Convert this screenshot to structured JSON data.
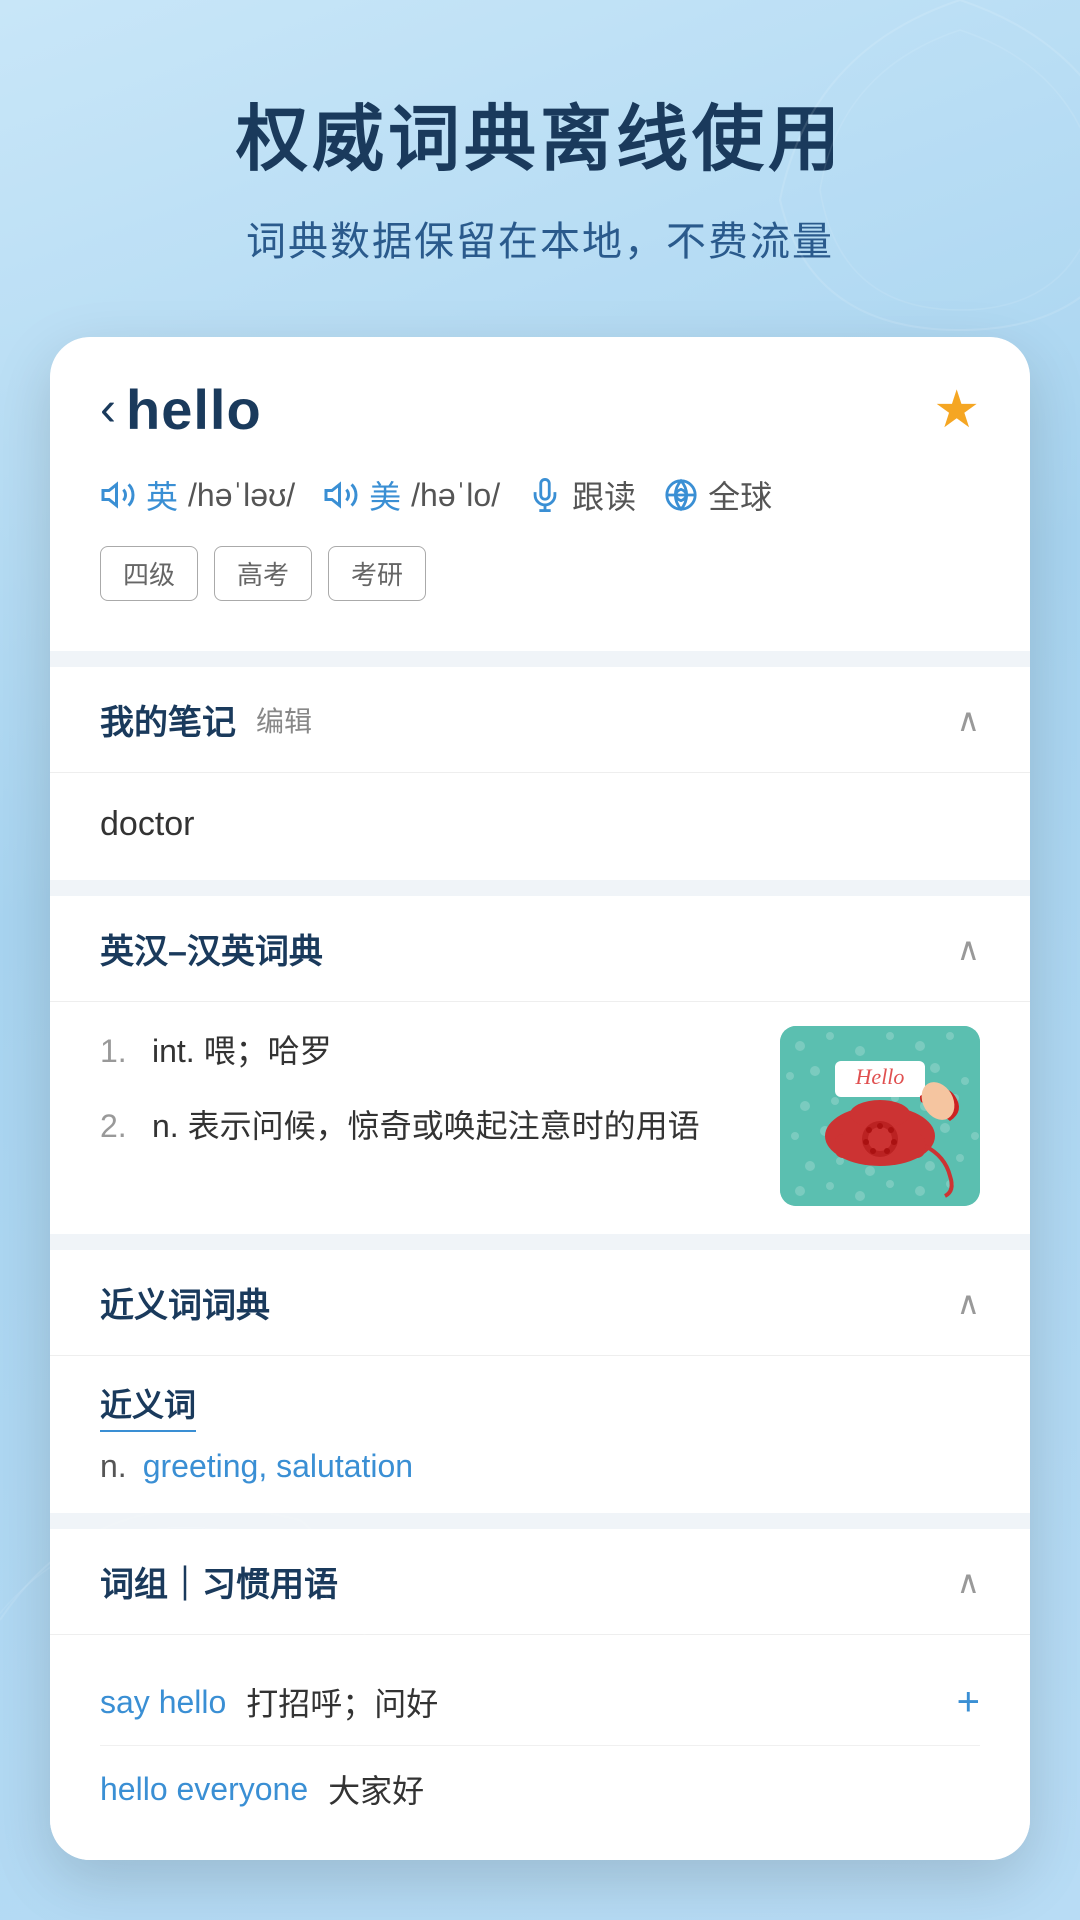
{
  "header": {
    "main_title": "权威词典离线使用",
    "sub_title": "词典数据保留在本地，不费流量"
  },
  "word_card": {
    "back_arrow": "‹",
    "word": "hello",
    "star": "★",
    "pronunciation": {
      "british": {
        "label": "英",
        "text": "/həˈləʊ/"
      },
      "american": {
        "label": "美",
        "text": "/həˈlo/"
      },
      "follow_read": "跟读",
      "global": "全球"
    },
    "tags": [
      "四级",
      "高考",
      "考研"
    ],
    "sections": {
      "notes": {
        "title": "我的笔记",
        "edit": "编辑",
        "content": "doctor"
      },
      "dictionary": {
        "title": "英汉–汉英词典",
        "definitions": [
          {
            "num": "1.",
            "type": "int.",
            "text": "喂；哈罗"
          },
          {
            "num": "2.",
            "type": "n.",
            "text": "表示问候，惊奇或唤起注意时的用语"
          }
        ]
      },
      "synonyms": {
        "title": "近义词词典",
        "label": "近义词",
        "pos": "n.",
        "words": "greeting, salutation"
      },
      "phrases": {
        "title": "词组｜习惯用语",
        "items": [
          {
            "en": "say hello",
            "cn": "打招呼；问好",
            "has_plus": true
          },
          {
            "en": "hello everyone",
            "cn": "大家好",
            "has_plus": false
          }
        ]
      }
    }
  }
}
